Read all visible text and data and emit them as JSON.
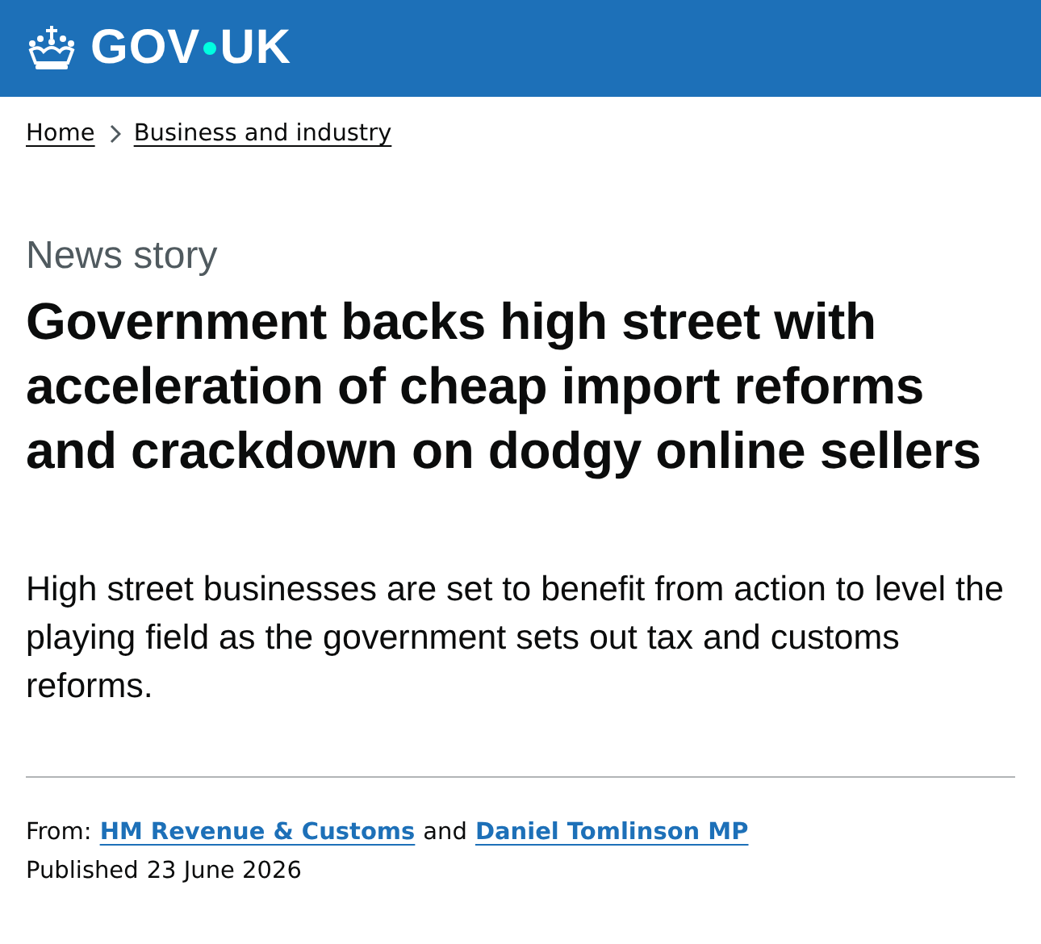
{
  "header": {
    "logo": [
      "GOV",
      "UK"
    ]
  },
  "breadcrumbs": [
    {
      "label": "Home"
    },
    {
      "label": "Business and industry"
    }
  ],
  "article": {
    "type": "News story",
    "title": "Government backs high street with acceleration of cheap import reforms and crackdown on dodgy online sellers",
    "lead": "High street businesses are set to benefit from action to level the playing field as the government sets out tax and customs reforms."
  },
  "metadata": {
    "from_label": "From:",
    "from_links": [
      "HM Revenue & Customs",
      "Daniel Tomlinson MP"
    ],
    "joiner": "and",
    "published_label": "Published",
    "published_date": "23 June 2026"
  }
}
